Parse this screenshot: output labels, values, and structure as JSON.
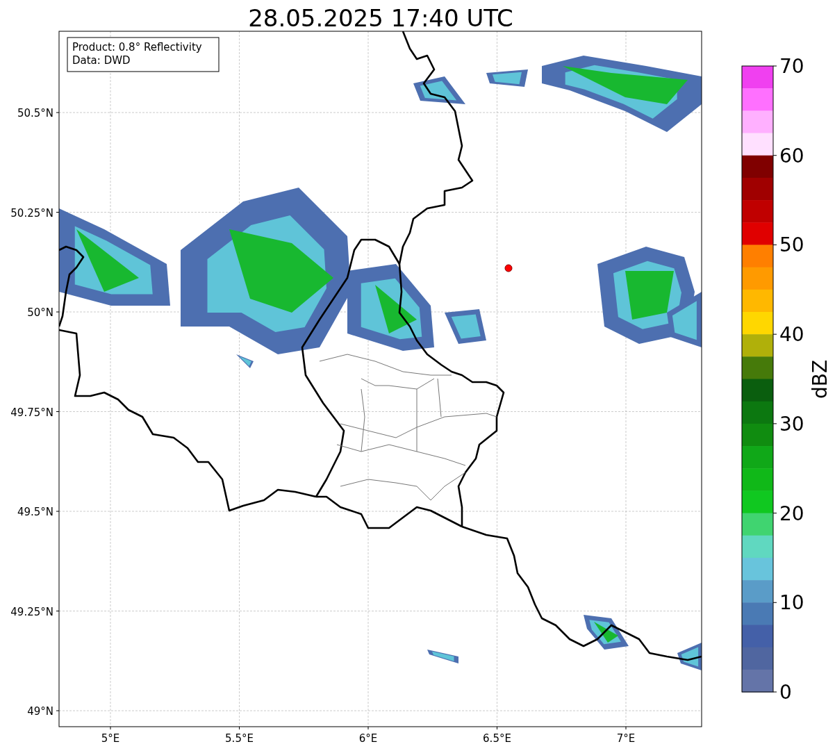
{
  "title": "28.05.2025 17:40 UTC",
  "info_box": [
    "Product: 0.8° Reflectivity",
    "Data: DWD"
  ],
  "lat_ticks": [
    "50.5°N",
    "50.25°N",
    "50°N",
    "49.75°N",
    "49.5°N",
    "49.25°N",
    "49°N"
  ],
  "lon_ticks": [
    "5°E",
    "5.5°E",
    "6°E",
    "6.5°E",
    "7°E"
  ],
  "colorbar": {
    "label": "dBZ",
    "ticks": [
      "70",
      "60",
      "50",
      "40",
      "30",
      "20",
      "10",
      "0"
    ],
    "segments": [
      {
        "color": "#f040f0"
      },
      {
        "color": "#ff70ff"
      },
      {
        "color": "#ffb0ff"
      },
      {
        "color": "#ffe0ff"
      },
      {
        "color": "#800000"
      },
      {
        "color": "#a00000"
      },
      {
        "color": "#c00000"
      },
      {
        "color": "#e00000"
      },
      {
        "color": "#ff7f00"
      },
      {
        "color": "#ff9a00"
      },
      {
        "color": "#ffb800"
      },
      {
        "color": "#ffd700"
      },
      {
        "color": "#b0b00a"
      },
      {
        "color": "#467a0a"
      },
      {
        "color": "#0a5e0e"
      },
      {
        "color": "#0c7810"
      },
      {
        "color": "#108c10"
      },
      {
        "color": "#10a818"
      },
      {
        "color": "#10b818"
      },
      {
        "color": "#10c820"
      },
      {
        "color": "#40d470"
      },
      {
        "color": "#60d8c0"
      },
      {
        "color": "#68c4dc"
      },
      {
        "color": "#5a9cc8"
      },
      {
        "color": "#4a7ab4"
      },
      {
        "color": "#4460a8"
      },
      {
        "color": "#5066a0"
      },
      {
        "color": "#6474a8"
      }
    ]
  }
}
